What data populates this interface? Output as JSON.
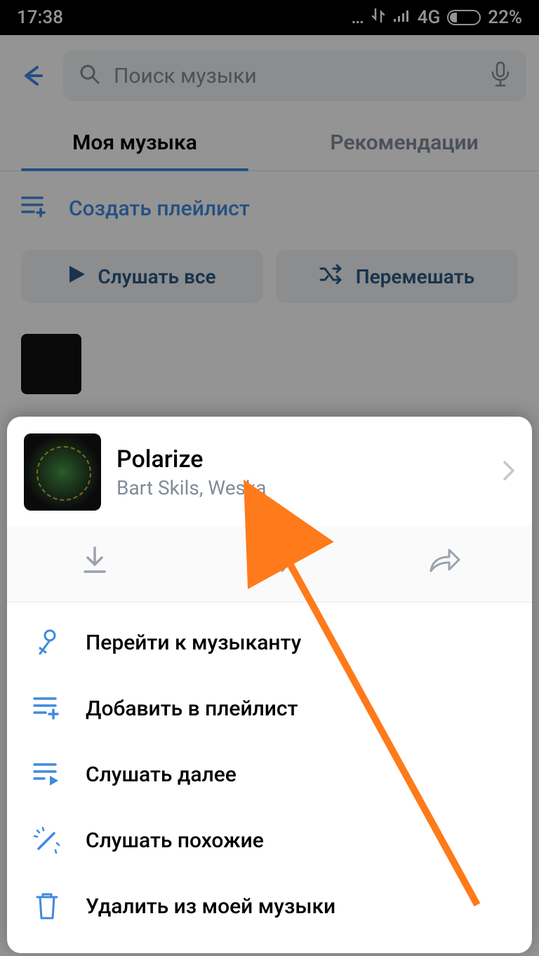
{
  "status": {
    "time": "17:38",
    "network": "4G",
    "battery": "22%"
  },
  "header": {
    "search_placeholder": "Поиск музыки"
  },
  "tabs": {
    "my_music": "Моя музыка",
    "recommendations": "Рекомендации"
  },
  "create_playlist": "Создать плейлист",
  "buttons": {
    "play_all": "Слушать все",
    "shuffle": "Перемешать"
  },
  "sheet": {
    "track": {
      "title": "Polarize",
      "artist": "Bart Skils, Weska"
    },
    "menu": {
      "go_to_artist": "Перейти к музыканту",
      "add_to_playlist": "Добавить в плейлист",
      "play_next": "Слушать далее",
      "play_similar": "Слушать похожие",
      "delete": "Удалить из моей музыки"
    }
  },
  "colors": {
    "accent": "#3f8ae0",
    "arrow": "#ff7a1a"
  }
}
